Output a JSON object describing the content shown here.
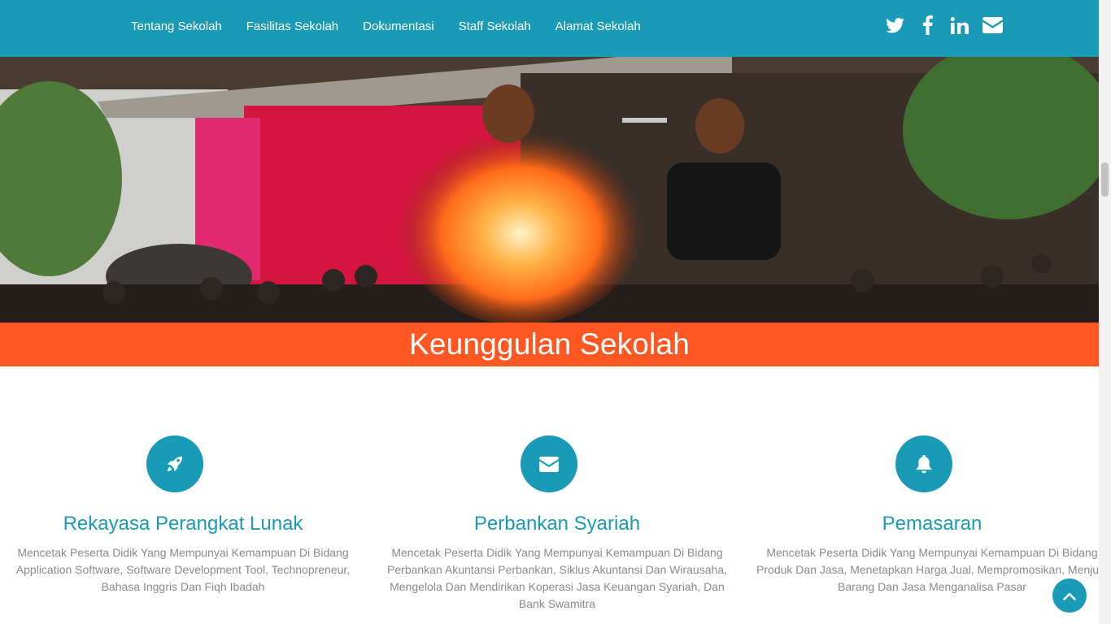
{
  "nav": {
    "links": [
      "Tentang Sekolah",
      "Fasilitas Sekolah",
      "Dokumentasi",
      "Staff Sekolah",
      "Alamat Sekolah"
    ],
    "social": [
      {
        "icon": "twitter-icon"
      },
      {
        "icon": "facebook-icon"
      },
      {
        "icon": "linkedin-icon"
      },
      {
        "icon": "envelope-icon"
      }
    ]
  },
  "hero": {
    "image": "fire-performance-photo"
  },
  "banner": {
    "title": "Keunggulan Sekolah"
  },
  "features": [
    {
      "icon": "rocket-icon",
      "title": "Rekayasa Perangkat Lunak",
      "description": "Mencetak Peserta Didik Yang Mempunyai Kemampuan Di Bidang Application Software, Software Development Tool, Technopreneur, Bahasa Inggris Dan Fiqh Ibadah"
    },
    {
      "icon": "envelope-icon",
      "title": "Perbankan Syariah",
      "description": "Mencetak Peserta Didik Yang Mempunyai Kemampuan Di Bidang Perbankan Akuntansi Perbankan, Siklus Akuntansi Dan Wirausaha, Mengelola Dan Mendirikan Koperasi Jasa Keuangan Syariah, Dan Bank Swamitra"
    },
    {
      "icon": "bell-icon",
      "title": "Pemasaran",
      "description": "Mencetak Peserta Didik Yang Mempunyai Kemampuan Di Bidang Produk Dan Jasa, Menetapkan Harga Jual, Mempromosikan, Menjual Barang Dan Jasa Menganalisa Pasar"
    }
  ],
  "colors": {
    "primary": "#199ab6",
    "accent": "#fe5722",
    "text_muted": "#8a8a8a"
  },
  "back_to_top": {
    "icon": "chevron-up-icon"
  }
}
